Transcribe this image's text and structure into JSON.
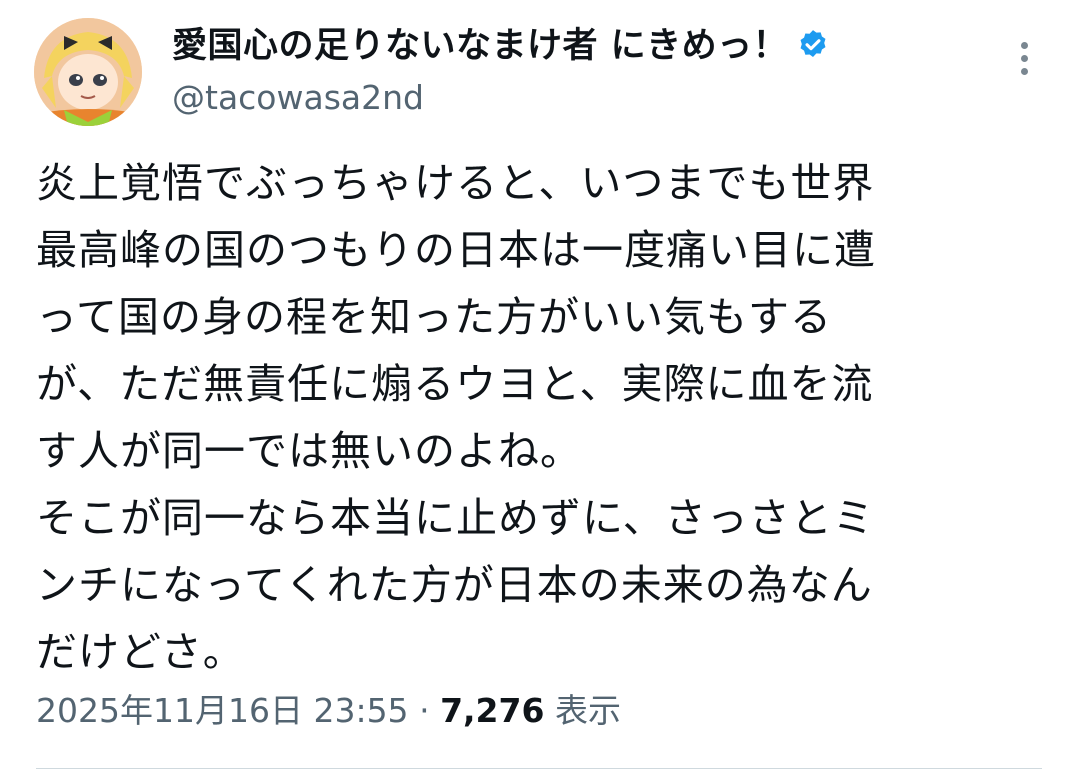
{
  "author": {
    "display_name": "愛国心の足りないなまけ者 にきめっ！",
    "handle": "@tacowasa2nd",
    "verified": true,
    "avatar_icon": "anime-character-avatar",
    "verified_icon": "verified-badge-icon",
    "verified_color": "#1d9bf0"
  },
  "tweet": {
    "text": "炎上覚悟でぶっちゃけると、いつまでも世界\n最高峰の国のつもりの日本は一度痛い目に遭\nって国の身の程を知った方がいい気もする\nが、ただ無責任に煽るウヨと、実際に血を流\nす人が同一では無いのよね。\nそこが同一なら本当に止めずに、さっさとミ\nンチになってくれた方が日本の未来の為なん\nだけどさ。",
    "timestamp": "2025年11月16日 23:55",
    "separator": "·",
    "views_count": "7,276",
    "views_label": "表示"
  },
  "more_icon": "more-vertical-icon"
}
